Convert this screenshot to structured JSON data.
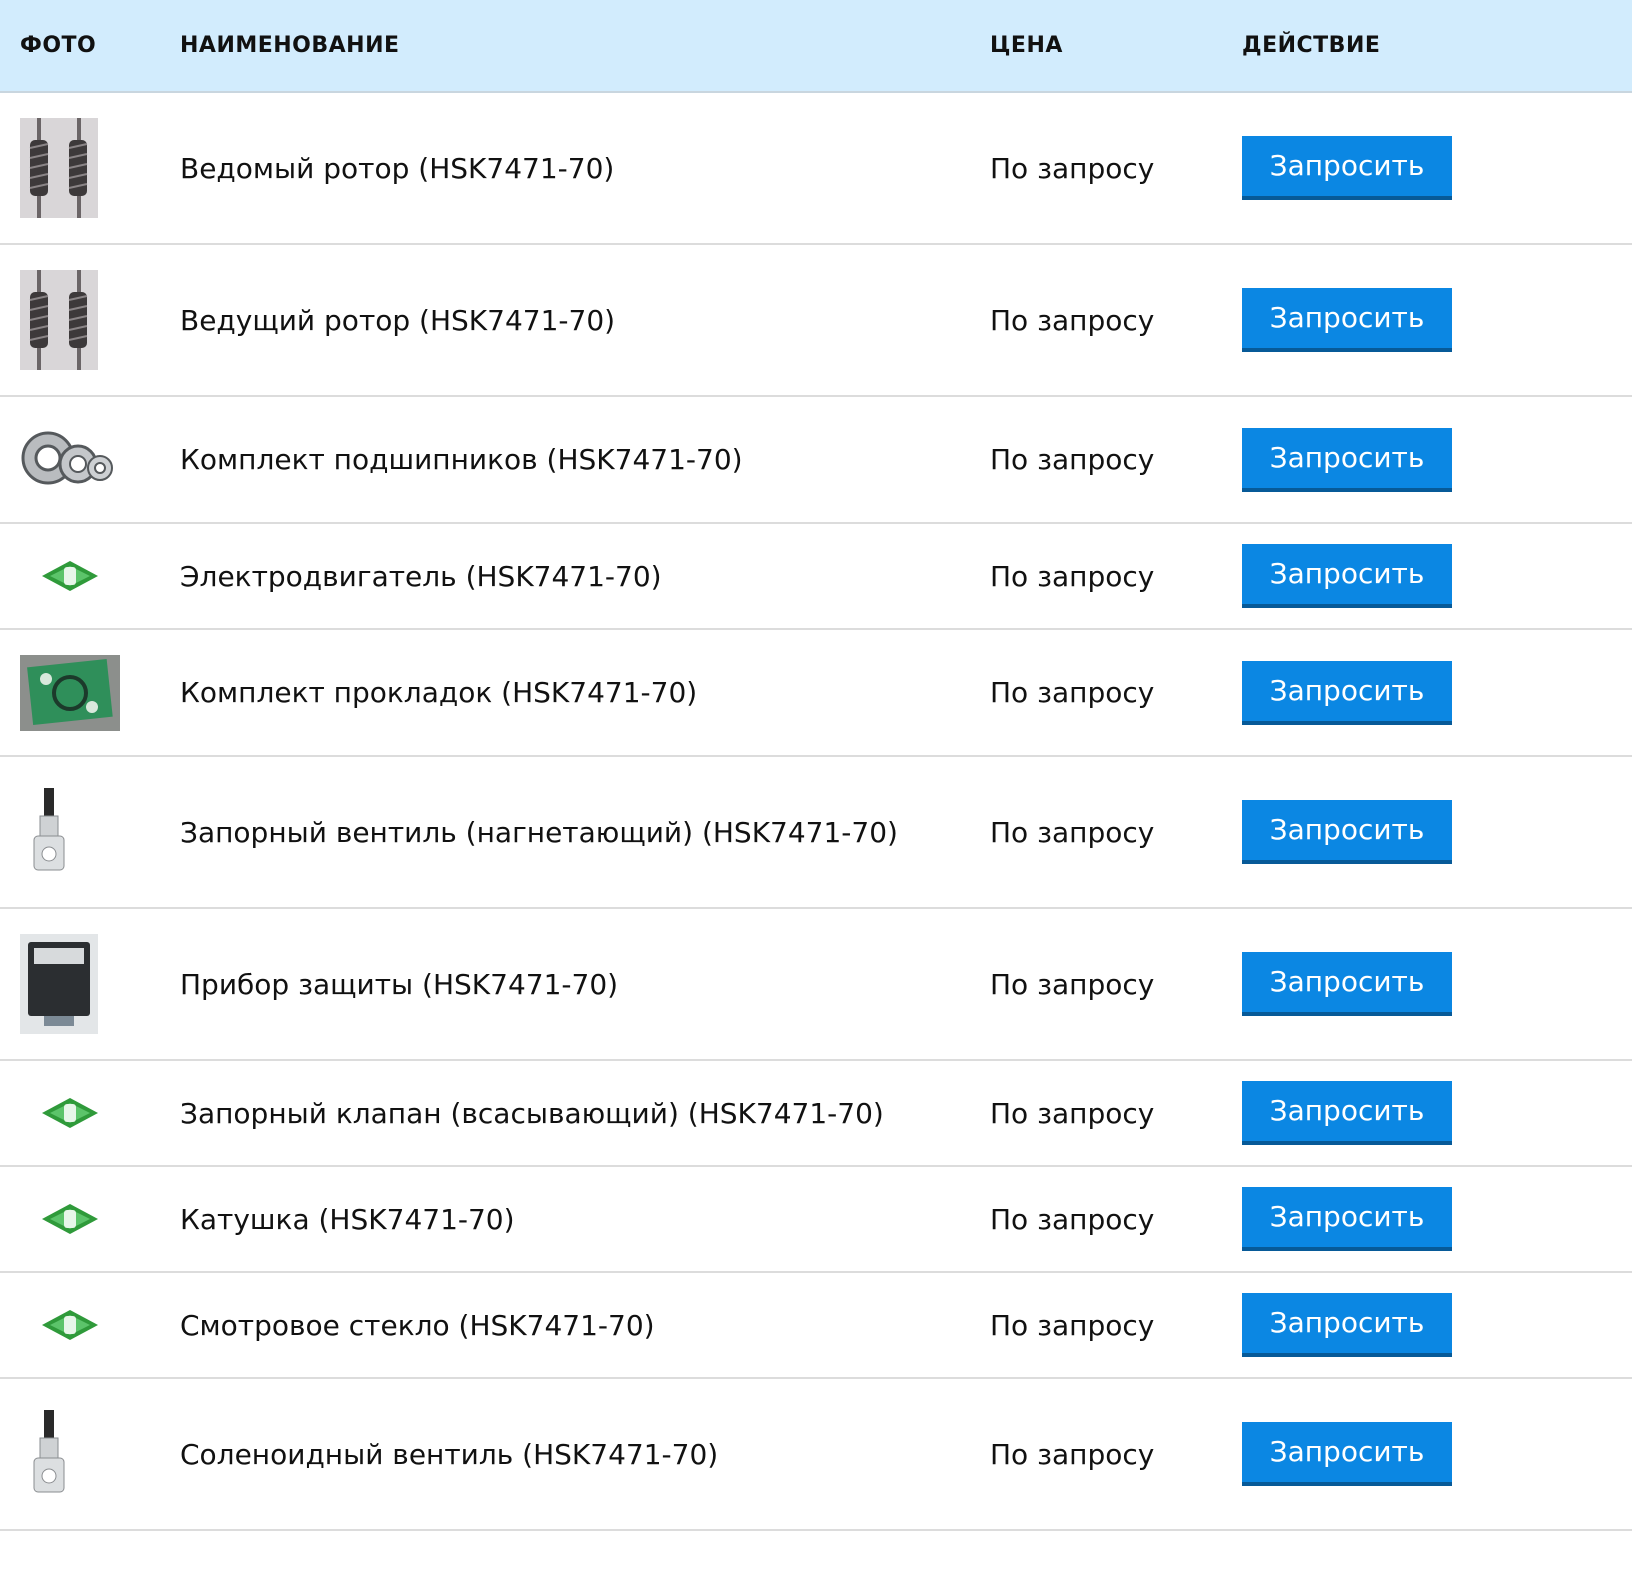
{
  "table": {
    "headers": {
      "photo": "ФОТО",
      "name": "НАИМЕНОВАНИЕ",
      "price": "ЦЕНА",
      "action": "ДЕЙСТВИЕ"
    },
    "rows": [
      {
        "name": "Ведомый ротор (HSK7471-70)",
        "price": "По запросу",
        "button": "Запросить",
        "photo_icon": "rotor-icon"
      },
      {
        "name": "Ведущий ротор (HSK7471-70)",
        "price": "По запросу",
        "button": "Запросить",
        "photo_icon": "rotor-icon"
      },
      {
        "name": "Комплект подшипников (HSK7471-70)",
        "price": "По запросу",
        "button": "Запросить",
        "photo_icon": "bearings-icon"
      },
      {
        "name": "Электродвигатель (HSK7471-70)",
        "price": "По запросу",
        "button": "Запросить",
        "photo_icon": "bitzer-logo-icon"
      },
      {
        "name": "Комплект прокладок (HSK7471-70)",
        "price": "По запросу",
        "button": "Запросить",
        "photo_icon": "gasket-set-icon"
      },
      {
        "name": "Запорный вентиль (нагнетающий) (HSK7471-70)",
        "price": "По запросу",
        "button": "Запросить",
        "photo_icon": "valve-icon"
      },
      {
        "name": "Прибор защиты (HSK7471-70)",
        "price": "По запросу",
        "button": "Запросить",
        "photo_icon": "protection-device-icon"
      },
      {
        "name": "Запорный клапан (всасывающий) (HSK7471-70)",
        "price": "По запросу",
        "button": "Запросить",
        "photo_icon": "bitzer-logo-icon"
      },
      {
        "name": "Катушка (HSK7471-70)",
        "price": "По запросу",
        "button": "Запросить",
        "photo_icon": "bitzer-logo-icon"
      },
      {
        "name": "Смотровое стекло (HSK7471-70)",
        "price": "По запросу",
        "button": "Запросить",
        "photo_icon": "bitzer-logo-icon"
      },
      {
        "name": "Соленоидный вентиль (HSK7471-70)",
        "price": "По запросу",
        "button": "Запросить",
        "photo_icon": "valve-icon"
      }
    ]
  },
  "colors": {
    "header_bg": "#d2ecfd",
    "button_bg": "#0b87e3",
    "button_border": "#075a98",
    "row_divider": "#dcdcdc"
  }
}
